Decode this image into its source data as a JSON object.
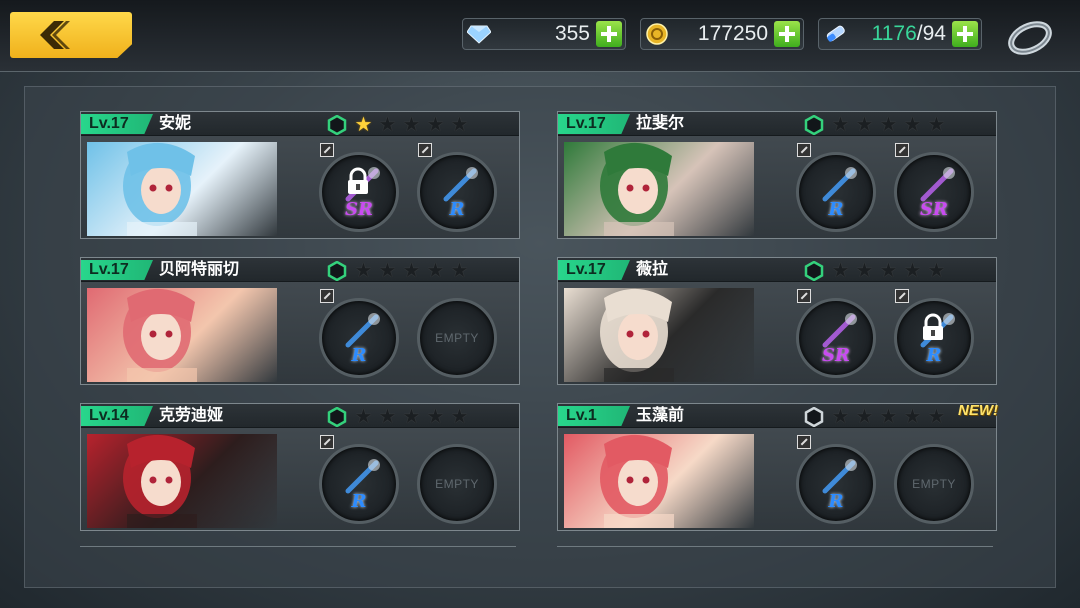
{
  "header": {
    "resources": [
      {
        "name": "diamonds",
        "value": "355",
        "icon": "diamond-icon"
      },
      {
        "name": "gold",
        "value": "177250",
        "icon": "gold-coin-icon"
      },
      {
        "name": "stamina",
        "value_current": "1176",
        "value_max": "/94",
        "icon": "stamina-potion-icon"
      }
    ]
  },
  "characters": [
    {
      "level": "Lv.17",
      "name": "安妮",
      "badge_color": "#34d17c",
      "stars": 1,
      "slots": [
        {
          "type": "item",
          "rarity": "SR",
          "locked": true
        },
        {
          "type": "item",
          "rarity": "R",
          "locked": false
        }
      ],
      "new": false,
      "portrait_colors": [
        "#6fc1e8",
        "#e6f2fa"
      ]
    },
    {
      "level": "Lv.17",
      "name": "拉斐尔",
      "badge_color": "#34d17c",
      "stars": 0,
      "slots": [
        {
          "type": "item",
          "rarity": "R",
          "locked": false
        },
        {
          "type": "item",
          "rarity": "SR",
          "locked": false
        }
      ],
      "new": false,
      "portrait_colors": [
        "#2f7a3a",
        "#d6c3b8"
      ]
    },
    {
      "level": "Lv.17",
      "name": "贝阿特丽切",
      "badge_color": "#34d17c",
      "stars": 0,
      "slots": [
        {
          "type": "item",
          "rarity": "R",
          "locked": false
        },
        {
          "type": "empty",
          "label": "EMPTY"
        }
      ],
      "new": false,
      "portrait_colors": [
        "#e06a72",
        "#f3c6ad"
      ]
    },
    {
      "level": "Lv.17",
      "name": "薇拉",
      "badge_color": "#34d17c",
      "stars": 0,
      "slots": [
        {
          "type": "item",
          "rarity": "SR",
          "locked": false
        },
        {
          "type": "item",
          "rarity": "R",
          "locked": true
        }
      ],
      "new": false,
      "portrait_colors": [
        "#e9ded2",
        "#2a2a2a"
      ]
    },
    {
      "level": "Lv.14",
      "name": "克劳迪娅",
      "badge_color": "#34d17c",
      "stars": 0,
      "slots": [
        {
          "type": "item",
          "rarity": "R",
          "locked": false
        },
        {
          "type": "empty",
          "label": "EMPTY"
        }
      ],
      "new": false,
      "portrait_colors": [
        "#b7222d",
        "#2d1d1d"
      ]
    },
    {
      "level": "Lv.1",
      "name": "玉藻前",
      "badge_color": "#1a1e21",
      "stars": 0,
      "slots": [
        {
          "type": "item",
          "rarity": "R",
          "locked": false
        },
        {
          "type": "empty",
          "label": "EMPTY"
        }
      ],
      "new": true,
      "new_label": "NEW!",
      "portrait_colors": [
        "#e25a63",
        "#f6d9c7"
      ]
    }
  ],
  "colors": {
    "accent_yellow": "#ffd84a",
    "level_green": "#28d68c",
    "star_gold": "#ffd23a"
  }
}
